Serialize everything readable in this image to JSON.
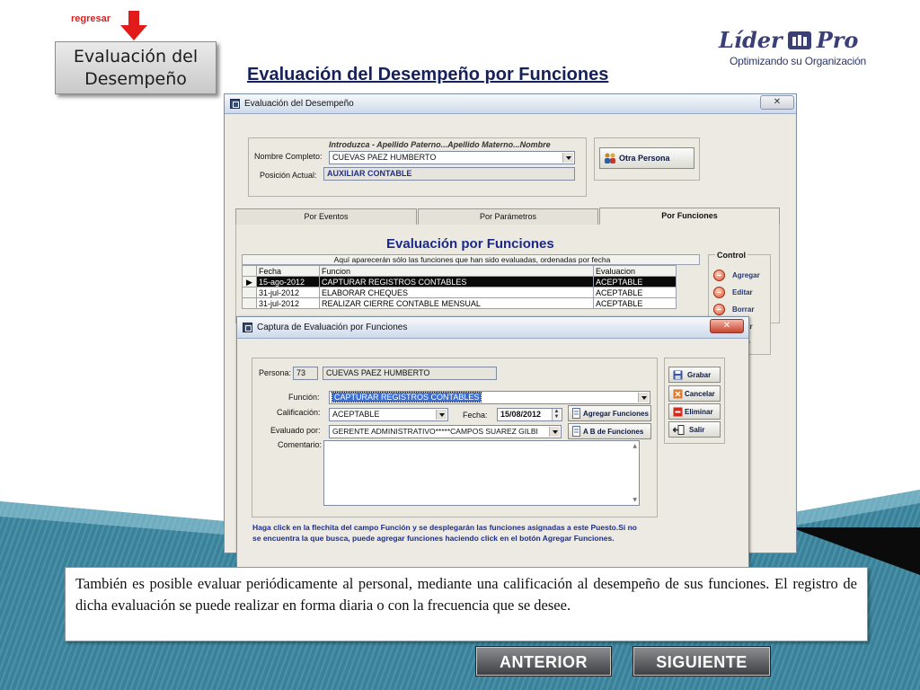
{
  "nav": {
    "back_link": "regresar",
    "section_title": "Evaluación del Desempeño"
  },
  "brand": {
    "name_part1": "Líder",
    "name_part2": "Pro",
    "tagline": "Optimizando su Organización",
    "color": "#3b3f78"
  },
  "page_title": "Evaluación del Desempeño por Funciones",
  "main_window": {
    "title": "Evaluación del Desempeño",
    "hint": "Introduzca - Apellido Paterno...Apellido Materno...Nombre",
    "nombre_label": "Nombre Completo:",
    "nombre_value": "CUEVAS PAEZ HUMBERTO",
    "posicion_label": "Posición Actual:",
    "posicion_value": "AUXILIAR CONTABLE",
    "otra_persona_label": "Otra Persona",
    "tabs": [
      "Por Eventos",
      "Por Parámetros",
      "Por Funciones"
    ],
    "eval_title": "Evaluación por Funciones",
    "grid_caption": "Aquí aparecerán sólo las funciones que han sido evaluadas, ordenadas por fecha",
    "grid_headers": [
      "Fecha",
      "Funcion",
      "Evaluacion"
    ],
    "grid_rows": [
      [
        "15-ago-2012",
        "CAPTURAR REGISTROS CONTABLES",
        "ACEPTABLE"
      ],
      [
        "31-jul-2012",
        "ELABORAR CHEQUES",
        "ACEPTABLE"
      ],
      [
        "31-jul-2012",
        "REALIZAR CIERRE CONTABLE MENSUAL",
        "ACEPTABLE"
      ]
    ],
    "control_title": "Control",
    "control_buttons": [
      "Agregar",
      "Editar",
      "Borrar",
      "zar",
      "r"
    ]
  },
  "dialog": {
    "title": "Captura de Evaluación por Funciones",
    "persona_label": "Persona:",
    "persona_id": "73",
    "persona_name": "CUEVAS PAEZ HUMBERTO",
    "funcion_label": "Función:",
    "funcion_value": "CAPTURAR REGISTROS CONTABLES",
    "calificacion_label": "Calificación:",
    "calificacion_value": "ACEPTABLE",
    "fecha_label": "Fecha:",
    "fecha_value": "15/08/2012",
    "agregar_funciones_label": "Agregar Funciones",
    "abc_funciones_label": "A B de  Funciones",
    "evaluado_label": "Evaluado por:",
    "evaluado_value": "GERENTE ADMINISTRATIVO*****CAMPOS SUAREZ GILBI",
    "comentario_label": "Comentario:",
    "buttons": [
      "Grabar",
      "Cancelar",
      "Eliminar",
      "Salir"
    ],
    "note": "Haga click en la flechita del campo Función y se desplegarán las funciones asignadas a este Puesto.Si no se encuentra la que busca, puede agregar funciones haciendo click en el botón Agregar Funciones."
  },
  "description": "También es posible evaluar periódicamente al personal, mediante una calificación al desempeño de sus funciones. El registro de dicha evaluación se puede realizar en forma diaria o con la frecuencia que se desee.",
  "navigation": {
    "prev": "ANTERIOR",
    "next": "SIGUIENTE"
  },
  "colors": {
    "accent_red": "#d62222",
    "title_blue": "#16205a",
    "selection": "#0a0a0a"
  }
}
